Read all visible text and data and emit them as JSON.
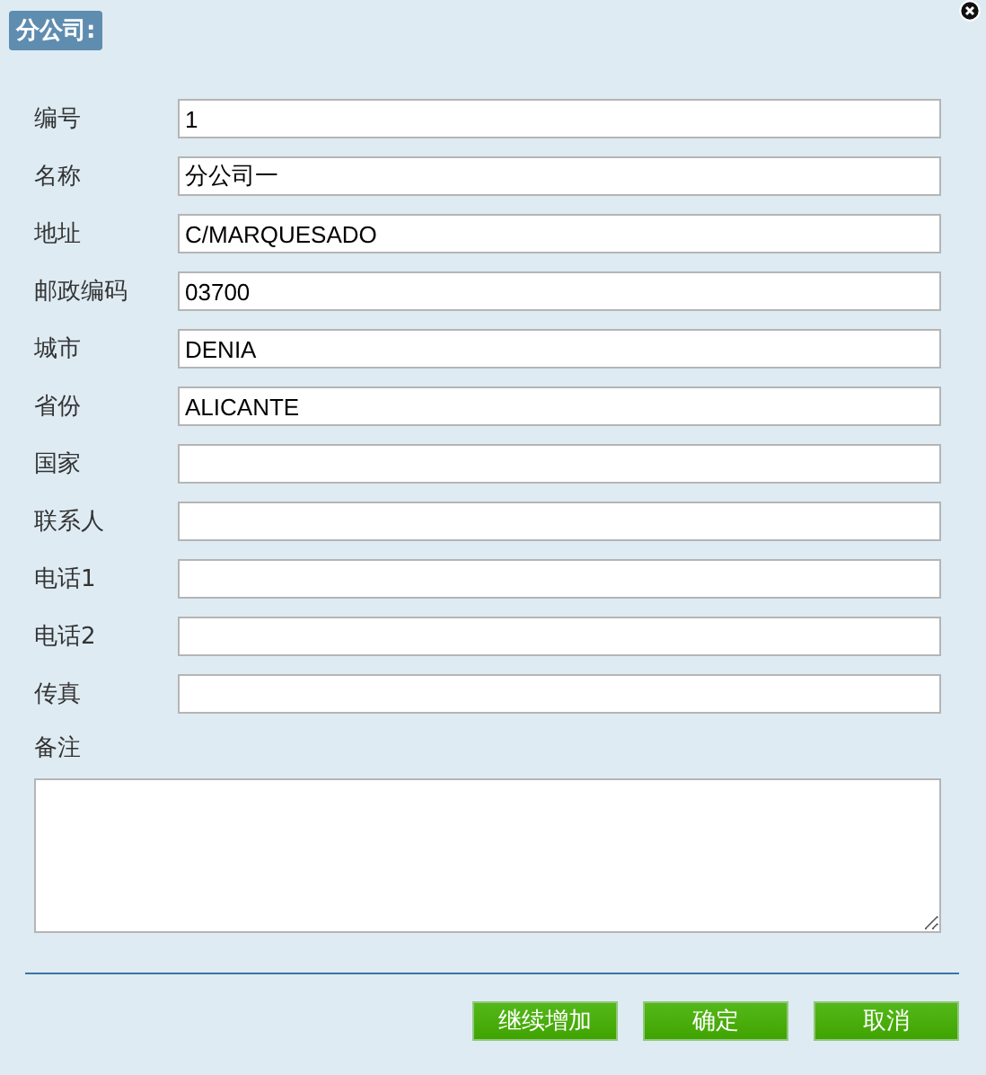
{
  "dialog": {
    "title": "分公司:"
  },
  "fields": [
    {
      "label": "编号",
      "value": "1"
    },
    {
      "label": "名称",
      "value": "分公司一"
    },
    {
      "label": "地址",
      "value": "C/MARQUESADO"
    },
    {
      "label": "邮政编码",
      "value": "03700"
    },
    {
      "label": "城市",
      "value": "DENIA"
    },
    {
      "label": "省份",
      "value": "ALICANTE"
    },
    {
      "label": "国家"
    },
    {
      "label": "联系人"
    },
    {
      "label": "电话1"
    },
    {
      "label": "电话2"
    },
    {
      "label": "传真"
    }
  ],
  "notes": {
    "label": "备注"
  },
  "buttons": [
    "继续增加",
    "确定",
    "取消"
  ]
}
